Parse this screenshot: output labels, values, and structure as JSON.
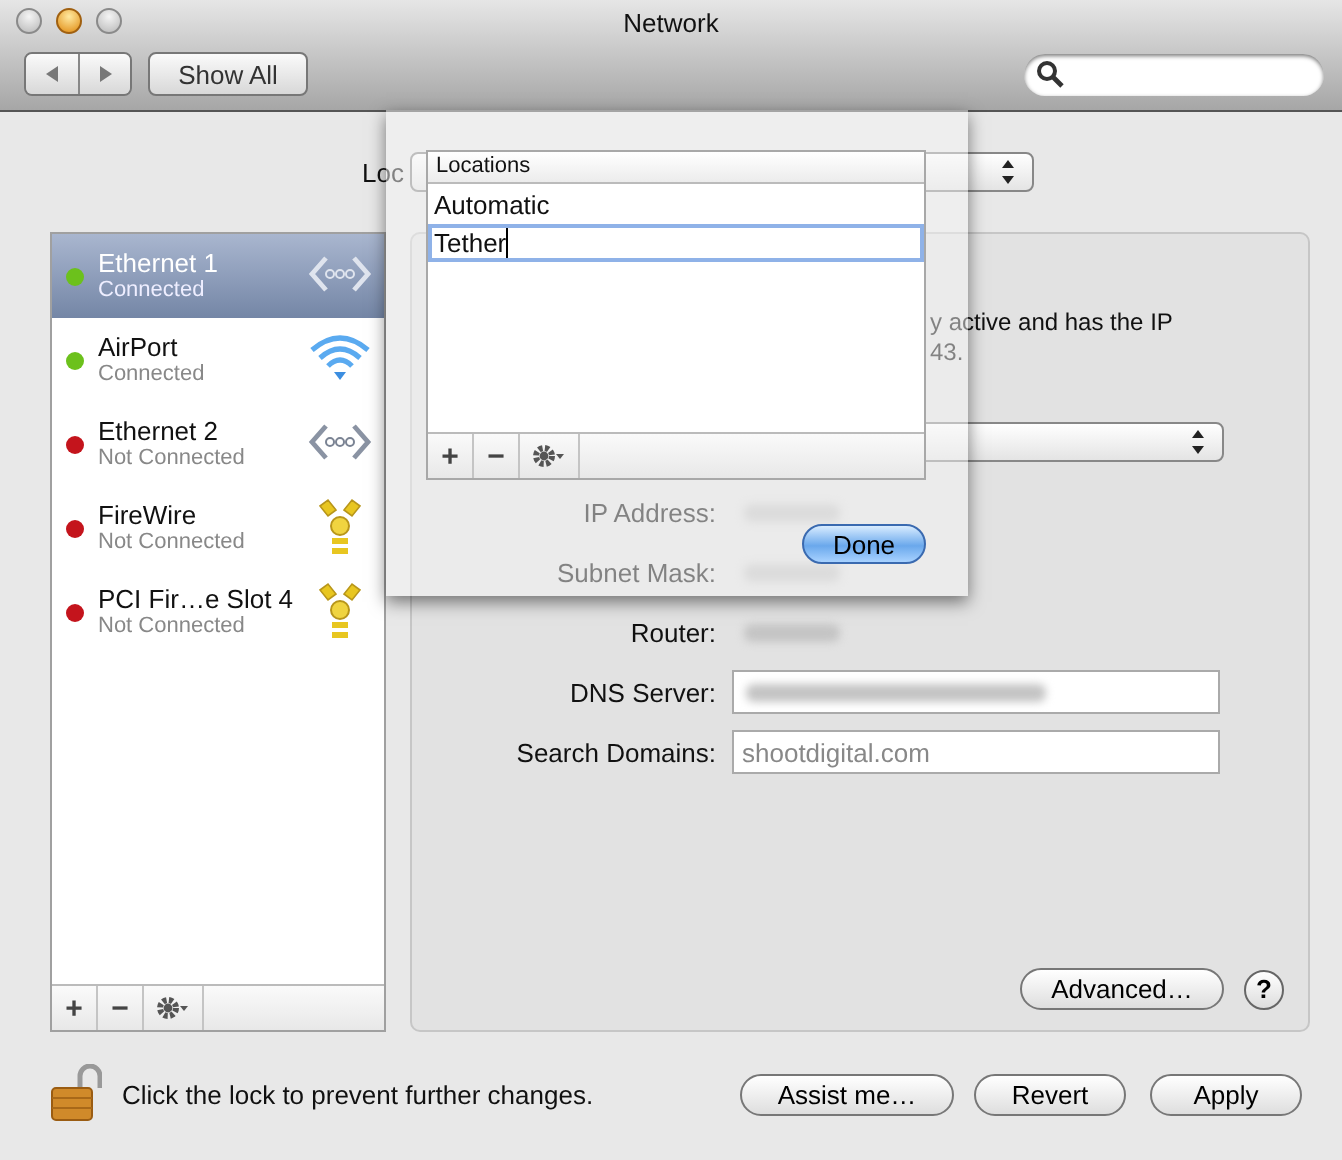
{
  "window": {
    "title": "Network"
  },
  "toolbar": {
    "show_all": "Show All"
  },
  "location": {
    "label": "Loc"
  },
  "services": [
    {
      "name": "Ethernet 1",
      "status": "Connected",
      "color": "#6cc11c",
      "kind": "ethernet",
      "selected": true
    },
    {
      "name": "AirPort",
      "status": "Connected",
      "color": "#6cc11c",
      "kind": "wifi",
      "selected": false
    },
    {
      "name": "Ethernet 2",
      "status": "Not Connected",
      "color": "#c4141c",
      "kind": "ethernet",
      "selected": false
    },
    {
      "name": "FireWire",
      "status": "Not Connected",
      "color": "#c4141c",
      "kind": "firewire",
      "selected": false
    },
    {
      "name": "PCI Fir…e Slot 4",
      "status": "Not Connected",
      "color": "#c4141c",
      "kind": "firewire",
      "selected": false
    }
  ],
  "list_buttons": [
    "+",
    "−"
  ],
  "status_text": [
    "y active and has the IP",
    "43."
  ],
  "form": [
    {
      "label": "IP Address:",
      "kind": "plain"
    },
    {
      "label": "Subnet Mask:",
      "kind": "plain"
    },
    {
      "label": "Router:",
      "kind": "plain"
    },
    {
      "label": "DNS Server:",
      "kind": "field"
    },
    {
      "label": "Search Domains:",
      "kind": "field",
      "placeholder": "shootdigital.com"
    }
  ],
  "advanced_button": "Advanced…",
  "help_button": "?",
  "lock_text": "Click the lock to prevent further changes.",
  "buttons": [
    "Assist me…",
    "Revert",
    "Apply"
  ],
  "sheet": {
    "header": "Locations",
    "locations": [
      {
        "name": "Automatic",
        "selected": false
      },
      {
        "name": "Tether",
        "selected": true
      }
    ],
    "list_buttons": [
      "+",
      "−"
    ],
    "done": "Done"
  }
}
